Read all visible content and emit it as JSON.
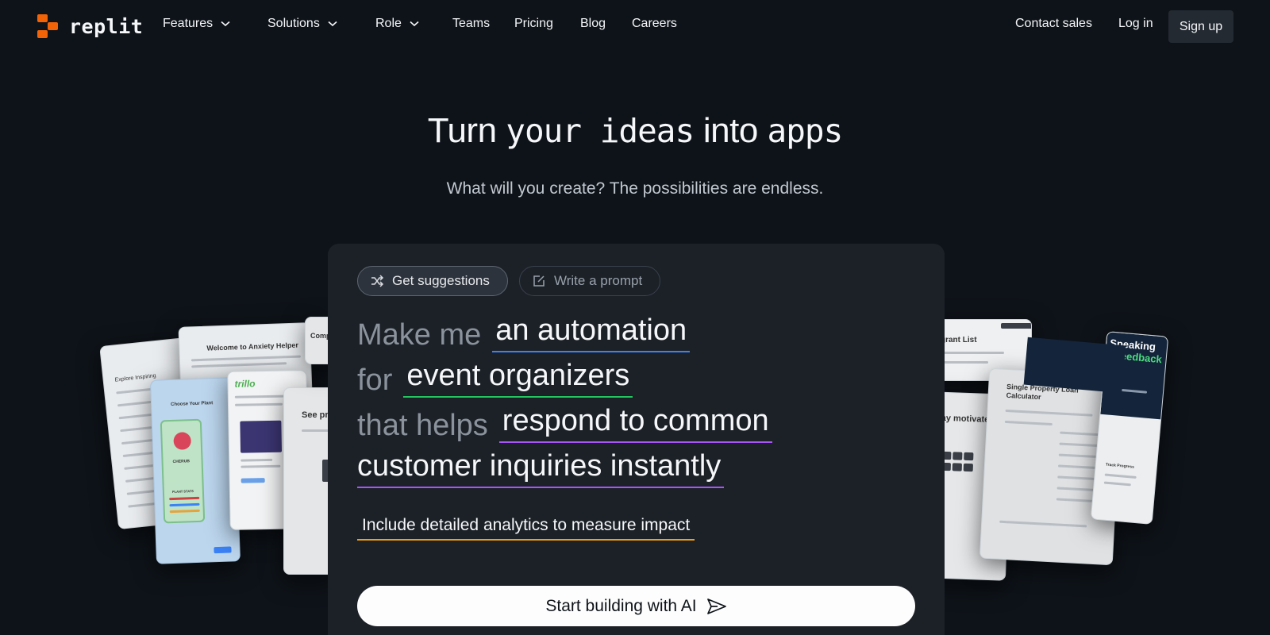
{
  "brand": {
    "name": "replit",
    "logo_color": "#f26207"
  },
  "nav": {
    "items": [
      {
        "label": "Features",
        "has_dropdown": true
      },
      {
        "label": "Solutions",
        "has_dropdown": true
      },
      {
        "label": "Role",
        "has_dropdown": true
      },
      {
        "label": "Teams",
        "has_dropdown": false
      },
      {
        "label": "Pricing",
        "has_dropdown": false
      },
      {
        "label": "Blog",
        "has_dropdown": false
      },
      {
        "label": "Careers",
        "has_dropdown": false
      }
    ],
    "contact_sales": "Contact sales",
    "log_in": "Log in",
    "sign_up": "Sign up"
  },
  "hero": {
    "title_a": "Turn ",
    "title_b": "your ideas",
    "title_c": " into ",
    "title_d": "apps",
    "subtitle": "What will you create? The possibilities are endless."
  },
  "prompt": {
    "tabs": {
      "suggestions": {
        "label": "Get suggestions",
        "icon": "shuffle-icon"
      },
      "write": {
        "label": "Write a prompt",
        "icon": "edit-icon"
      }
    },
    "line1": {
      "prefix": "Make me",
      "value": "an automation",
      "accent": "#3b82f6"
    },
    "line2": {
      "prefix": "for",
      "value": "event organizers",
      "accent": "#22c55e"
    },
    "line3": {
      "prefix": "that helps",
      "value": "respond to common",
      "accent": "#a855f7"
    },
    "line4": {
      "value": "customer inquiries instantly",
      "accent": "#a855f7"
    },
    "extra": {
      "value": "Include detailed analytics to measure impact",
      "accent": "#f59e0b"
    },
    "cta": {
      "label": "Start building with AI",
      "icon": "send-icon"
    }
  },
  "preview_cards": {
    "anxiety": {
      "title": "Welcome to Anxiety Helper"
    },
    "plant": {
      "title": "Choose Your Plant",
      "name": "CHERUB",
      "stats_label": "PLANT STATS"
    },
    "trillo": {
      "brand": "trillo"
    },
    "see": {
      "text": "See pre"
    },
    "comp": {
      "text": "Comp"
    },
    "explore": {
      "text": "Explore Inspiring"
    },
    "migrant": {
      "title": "grant List"
    },
    "motivated": {
      "text": "stay motivated"
    },
    "loan": {
      "title": "Single Property Loan Calculator"
    },
    "speaking": {
      "title_a": "Master Public Speaking with ",
      "title_b": "AI-Powered Feedback",
      "subtext": "Track Progress"
    }
  }
}
